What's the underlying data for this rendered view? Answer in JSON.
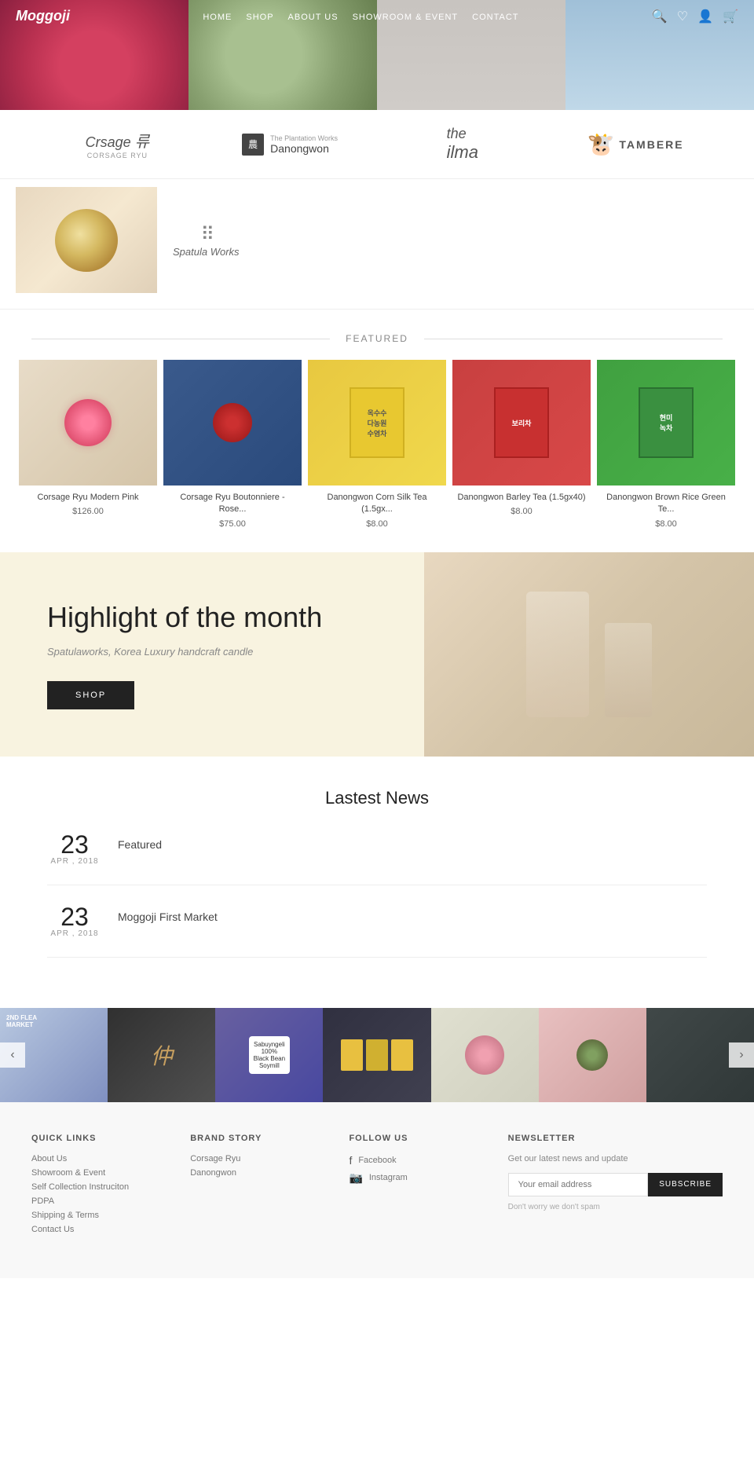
{
  "site": {
    "name": "Moggoji"
  },
  "nav": {
    "links": [
      {
        "label": "HOME",
        "href": "#"
      },
      {
        "label": "SHOP",
        "href": "#"
      },
      {
        "label": "ABOUT US",
        "href": "#"
      },
      {
        "label": "SHOWROOM & EVENT",
        "href": "#"
      },
      {
        "label": "CONTACT",
        "href": "#"
      }
    ]
  },
  "brands": [
    {
      "name": "Corsage Ryu",
      "script": "Crsage 류",
      "sub": "CORSAGE RYU"
    },
    {
      "name": "Danongwon",
      "korean": "다농원",
      "sub": "The Plantation Works Danongwon"
    },
    {
      "name": "The Ilma",
      "text": "the ilma"
    },
    {
      "name": "Tambere",
      "text": "TAMBERE"
    }
  ],
  "spatula": {
    "name": "Spatula Works",
    "icon": "||||",
    "text": "Spatula Works"
  },
  "featured": {
    "section_label": "FEATURED",
    "items": [
      {
        "name": "Corsage Ryu Modern Pink",
        "price": "$126.00",
        "type": "corsage1"
      },
      {
        "name": "Corsage Ryu Boutonniere - Rose...",
        "price": "$75.00",
        "type": "corsage2"
      },
      {
        "name": "Danongwon Corn Silk Tea (1.5gx...",
        "price": "$8.00",
        "type": "tea1"
      },
      {
        "name": "Danongwon Barley Tea (1.5gx40)",
        "price": "$8.00",
        "type": "tea2"
      },
      {
        "name": "Danongwon Brown Rice Green Te...",
        "price": "$8.00",
        "type": "tea3"
      }
    ]
  },
  "highlight": {
    "title": "Highlight of the month",
    "subtitle": "Spatulaworks, Korea Luxury handcraft candle",
    "button_label": "SHOP"
  },
  "news": {
    "title": "Lastest News",
    "items": [
      {
        "day": "23",
        "month_year": "APR , 2018",
        "title": "Featured"
      },
      {
        "day": "23",
        "month_year": "APR , 2018",
        "title": "Moggoji First Market"
      }
    ]
  },
  "footer": {
    "quick_links": {
      "title": "QUICK LINKS",
      "links": [
        "About Us",
        "Showroom & Event",
        "Self Collection Instruciton",
        "PDPA",
        "Shipping & Terms",
        "Contact Us"
      ]
    },
    "brand_story": {
      "title": "BRAND STORY",
      "links": [
        "Corsage Ryu",
        "Danongwon"
      ]
    },
    "follow_us": {
      "title": "FOLLOW US",
      "links": [
        {
          "icon": "f",
          "label": "Facebook"
        },
        {
          "icon": "📷",
          "label": "Instagram"
        }
      ]
    },
    "newsletter": {
      "title": "NEWSLETTER",
      "description": "Get our latest news and update",
      "placeholder": "Your email address",
      "button_label": "SUBSCRIBE",
      "note": "Don't worry we don't spam"
    }
  }
}
